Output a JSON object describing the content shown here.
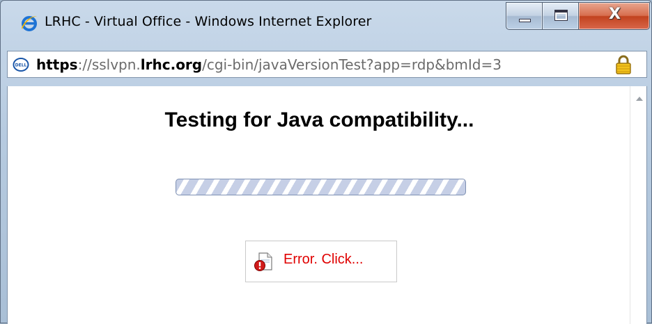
{
  "window": {
    "title": "LRHC - Virtual Office - Windows Internet Explorer",
    "buttons": {
      "minimize": "minimize",
      "maximize": "maximize",
      "close": "X"
    }
  },
  "address_bar": {
    "scheme": "https",
    "separator": "://",
    "host_prefix": "sslvpn.",
    "host_domain": "lrhc.org",
    "path": "/cgi-bin/javaVersionTest?app=rdp&bmId=3",
    "site_icon": "dell-icon",
    "security_icon": "lock-icon"
  },
  "page": {
    "heading": "Testing for Java compatibility...",
    "progress": {
      "state": "indeterminate"
    },
    "error_button": {
      "label": "Error. Click...",
      "icon": "document-error-icon",
      "color": "#e00000"
    }
  },
  "colors": {
    "frame": "#b7cbe0",
    "close_button": "#c2431f",
    "error_text": "#e00000",
    "progress_stripe": "#c6cfe6"
  }
}
